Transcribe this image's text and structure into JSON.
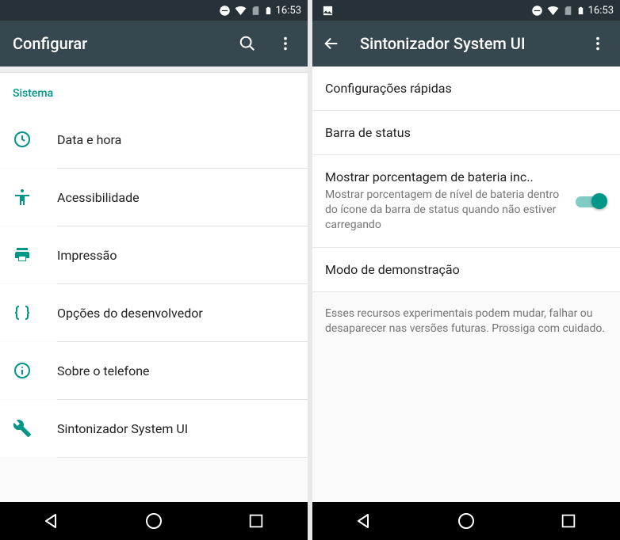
{
  "status": {
    "time": "16:53"
  },
  "left": {
    "title": "Configurar",
    "section": "Sistema",
    "items": [
      {
        "label": "Data e hora"
      },
      {
        "label": "Acessibilidade"
      },
      {
        "label": "Impressão"
      },
      {
        "label": "Opções do desenvolvedor"
      },
      {
        "label": "Sobre o telefone"
      },
      {
        "label": "Sintonizador System UI"
      }
    ]
  },
  "right": {
    "title": "Sintonizador System UI",
    "items": {
      "quick": "Configurações rápidas",
      "statusbar": "Barra de status",
      "battery_title": "Mostrar porcentagem de bateria inc..",
      "battery_desc": "Mostrar porcentagem de nível de bateria dentro do ícone da barra de status quando não estiver carregando",
      "demo": "Modo de demonstração",
      "footnote": "Esses recursos experimentais podem mudar, falhar ou desaparecer nas versões futuras. Prossiga com cuidado."
    }
  }
}
